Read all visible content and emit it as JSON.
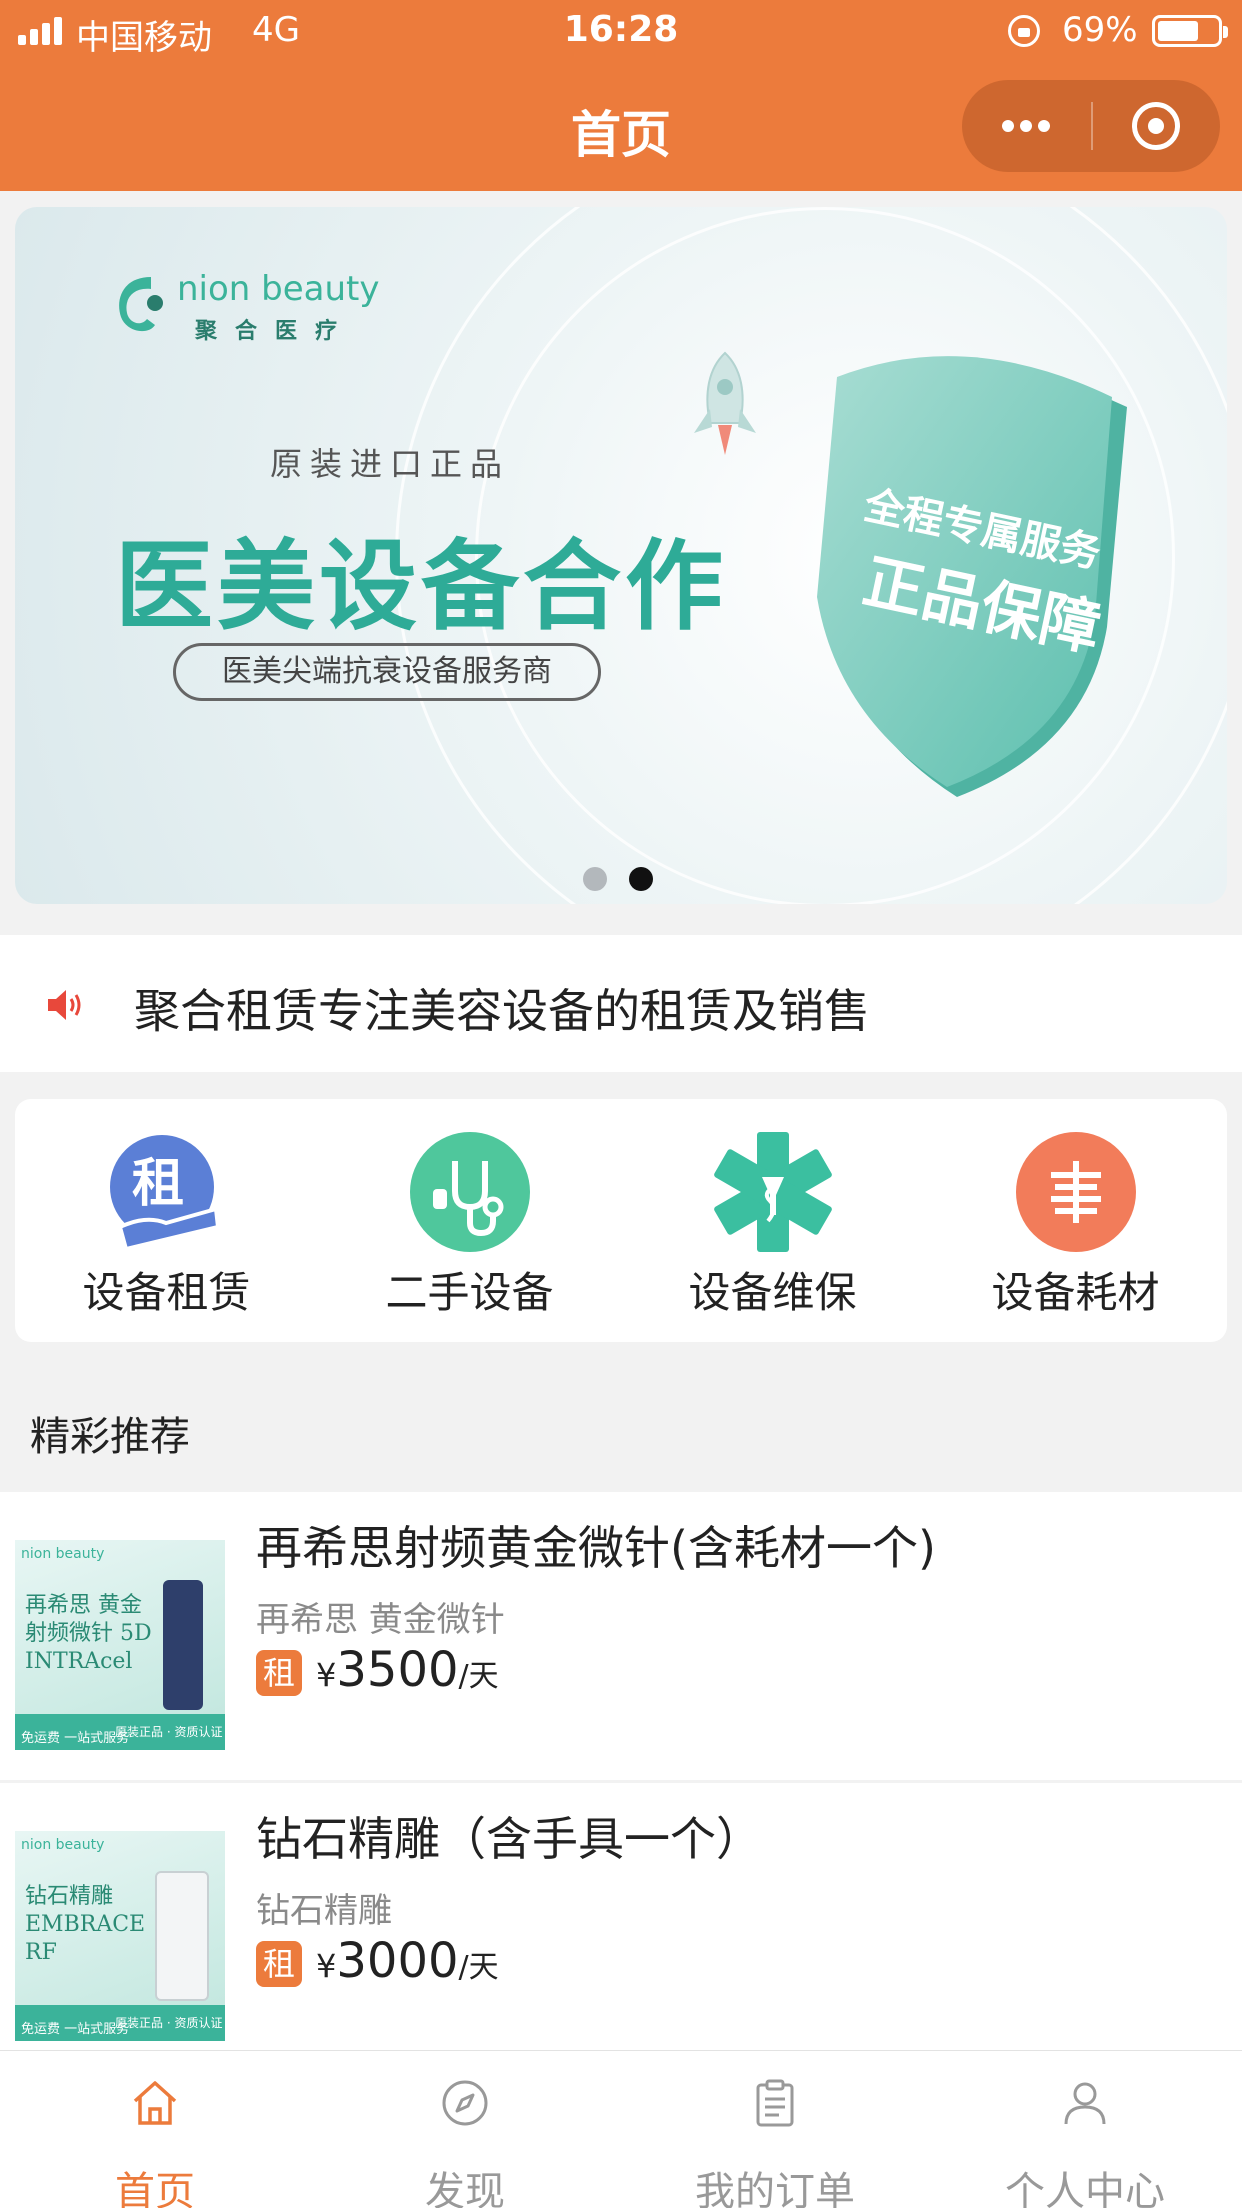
{
  "status_bar": {
    "carrier": "中国移动",
    "network": "4G",
    "time": "16:28",
    "battery": "69%"
  },
  "header": {
    "title": "首页"
  },
  "banner": {
    "brand_name": "nion beauty",
    "brand_sub": "聚合医疗",
    "tag": "原装进口正品",
    "title": "医美设备合作",
    "subtitle": "医美尖端抗衰设备服务商",
    "shield_line1": "全程专属服务",
    "shield_line2": "正品保障",
    "slide_index": 2,
    "slide_count": 2
  },
  "notice": {
    "text": "聚合租赁专注美容设备的租赁及销售"
  },
  "categories": [
    {
      "label": "设备租赁",
      "icon": "rent-icon",
      "icon_char": "租",
      "color": "#5b7fd6"
    },
    {
      "label": "二手设备",
      "icon": "stethoscope-icon",
      "color": "#4fc79c"
    },
    {
      "label": "设备维保",
      "icon": "medical-star-icon",
      "color": "#3bbfa0"
    },
    {
      "label": "设备耗材",
      "icon": "consumables-icon",
      "color": "#f27c5a"
    }
  ],
  "section": {
    "title": "精彩推荐"
  },
  "products": [
    {
      "name": "再希思射频黄金微针(含耗材一个)",
      "sub": "再希思 黄金微针",
      "badge": "租",
      "currency": "¥",
      "price": "3500",
      "unit": "/天",
      "thumb": {
        "logo": "nion beauty",
        "name": "再希思 黄金射频微针 5D INTRAcel",
        "foot_left": "免运费 一站式服务",
        "foot_right": "原装正品 · 资质认证"
      }
    },
    {
      "name": "钻石精雕（含手具一个）",
      "sub": "钻石精雕",
      "badge": "租",
      "currency": "¥",
      "price": "3000",
      "unit": "/天",
      "thumb": {
        "logo": "nion beauty",
        "name": "钻石精雕 EMBRACE RF",
        "foot_left": "免运费 一站式服务",
        "foot_right": "原装正品 · 资质认证"
      }
    }
  ],
  "tabbar": [
    {
      "label": "首页",
      "icon": "home-icon",
      "active": true
    },
    {
      "label": "发现",
      "icon": "compass-icon",
      "active": false
    },
    {
      "label": "我的订单",
      "icon": "clipboard-icon",
      "active": false
    },
    {
      "label": "个人中心",
      "icon": "user-icon",
      "active": false
    }
  ],
  "colors": {
    "accent": "#ec7b3c",
    "banner_green": "#2eab97"
  }
}
